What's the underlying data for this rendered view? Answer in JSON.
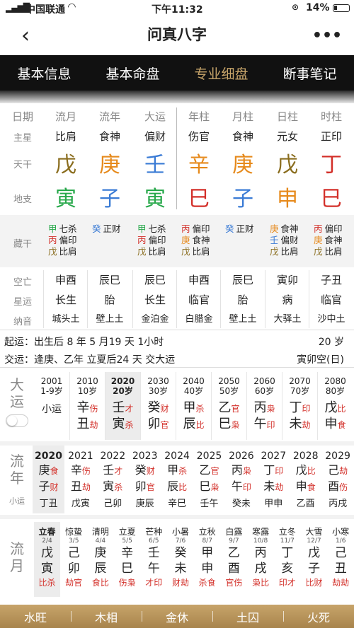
{
  "status": {
    "carrier": "中国联通",
    "time": "下午11:32",
    "battery": "14%"
  },
  "nav": {
    "title": "问真八字"
  },
  "tabs": [
    "基本信息",
    "基本命盘",
    "专业细盘",
    "断事笔记"
  ],
  "headers": [
    "日期",
    "流月",
    "流年",
    "大运",
    "年柱",
    "月柱",
    "日柱",
    "时柱"
  ],
  "zhuxing": {
    "label": "主星",
    "values": [
      "比肩",
      "食神",
      "偏财",
      "伤官",
      "食神",
      "元女",
      "正印"
    ]
  },
  "tiangan": {
    "label": "天干",
    "chars": [
      "戊",
      "庚",
      "壬",
      "辛",
      "庚",
      "戊",
      "丁"
    ],
    "colors": [
      "#8a6d1e",
      "#e68a1c",
      "#3a7bd5",
      "#e68a1c",
      "#e68a1c",
      "#8a6d1e",
      "#d3302a"
    ]
  },
  "dizhi": {
    "label": "地支",
    "chars": [
      "寅",
      "子",
      "寅",
      "巳",
      "子",
      "申",
      "巳"
    ],
    "colors": [
      "#27a84a",
      "#3a7bd5",
      "#27a84a",
      "#d3302a",
      "#3a7bd5",
      "#e68a1c",
      "#d3302a"
    ]
  },
  "canggan": {
    "label": "藏干",
    "cols": [
      [
        [
          "甲",
          "七杀",
          "#27a84a"
        ],
        [
          "丙",
          "偏印",
          "#d3302a"
        ],
        [
          "戊",
          "比肩",
          "#8a6d1e"
        ]
      ],
      [
        [
          "癸",
          "正财",
          "#3a7bd5"
        ]
      ],
      [
        [
          "甲",
          "七杀",
          "#27a84a"
        ],
        [
          "丙",
          "偏印",
          "#d3302a"
        ],
        [
          "戊",
          "比肩",
          "#8a6d1e"
        ]
      ],
      [
        [
          "丙",
          "偏印",
          "#d3302a"
        ],
        [
          "庚",
          "食神",
          "#e68a1c"
        ],
        [
          "戊",
          "比肩",
          "#8a6d1e"
        ]
      ],
      [
        [
          "癸",
          "正财",
          "#3a7bd5"
        ]
      ],
      [
        [
          "庚",
          "食神",
          "#e68a1c"
        ],
        [
          "壬",
          "偏财",
          "#3a7bd5"
        ],
        [
          "戊",
          "比肩",
          "#8a6d1e"
        ]
      ],
      [
        [
          "丙",
          "偏印",
          "#d3302a"
        ],
        [
          "庚",
          "食神",
          "#e68a1c"
        ],
        [
          "戊",
          "比肩",
          "#8a6d1e"
        ]
      ]
    ]
  },
  "kongwang": {
    "label": "空亡",
    "values": [
      "申酉",
      "辰巳",
      "辰巳",
      "申酉",
      "辰巳",
      "寅卯",
      "子丑"
    ]
  },
  "xingyun": {
    "label": "星运",
    "values": [
      "长生",
      "胎",
      "长生",
      "临官",
      "胎",
      "病",
      "临官"
    ]
  },
  "nayin": {
    "label": "纳音",
    "values": [
      "城头土",
      "壁上土",
      "金泊金",
      "白腊金",
      "壁上土",
      "大驿土",
      "沙中土"
    ]
  },
  "qiyun": {
    "text": "起运：出生后 8 年 5 月19 天 1小时",
    "age": "20 岁"
  },
  "jiaoyun": {
    "text": "交运：逢庚、乙年 立夏后24 天 交大运",
    "kong": "寅卯空(日)"
  },
  "dayun": {
    "label": "大运",
    "cols": [
      {
        "year": "2001",
        "age": "1-9岁",
        "name": "小运",
        "gz": []
      },
      {
        "year": "2010",
        "age": "10岁",
        "gz": [
          [
            "辛",
            "伤",
            "#e68a1c"
          ],
          [
            "丑",
            "劫",
            "#8a6d1e"
          ]
        ]
      },
      {
        "year": "2020",
        "age": "20岁",
        "gz": [
          [
            "壬",
            "才",
            "#3a7bd5"
          ],
          [
            "寅",
            "杀",
            "#27a84a"
          ]
        ],
        "active": true
      },
      {
        "year": "2030",
        "age": "30岁",
        "gz": [
          [
            "癸",
            "财",
            "#3a7bd5"
          ],
          [
            "卯",
            "官",
            "#27a84a"
          ]
        ]
      },
      {
        "year": "2040",
        "age": "40岁",
        "gz": [
          [
            "甲",
            "杀",
            "#27a84a"
          ],
          [
            "辰",
            "比",
            "#8a6d1e"
          ]
        ]
      },
      {
        "year": "2050",
        "age": "50岁",
        "gz": [
          [
            "乙",
            "官",
            "#27a84a"
          ],
          [
            "巳",
            "枭",
            "#d3302a"
          ]
        ]
      },
      {
        "year": "2060",
        "age": "60岁",
        "gz": [
          [
            "丙",
            "枭",
            "#d3302a"
          ],
          [
            "午",
            "印",
            "#d3302a"
          ]
        ]
      },
      {
        "year": "2070",
        "age": "70岁",
        "gz": [
          [
            "丁",
            "印",
            "#d3302a"
          ],
          [
            "未",
            "劫",
            "#8a6d1e"
          ]
        ]
      },
      {
        "year": "2080",
        "age": "80岁",
        "gz": [
          [
            "戊",
            "比",
            "#8a6d1e"
          ],
          [
            "申",
            "食",
            "#e68a1c"
          ]
        ]
      }
    ]
  },
  "liunian": {
    "label": "流年",
    "sub": "小运",
    "cols": [
      {
        "year": "2020",
        "gz": [
          [
            "庚",
            "食",
            "#e68a1c"
          ],
          [
            "子",
            "财",
            "#3a7bd5"
          ]
        ],
        "xy": "丁丑",
        "active": true
      },
      {
        "year": "2021",
        "gz": [
          [
            "辛",
            "伤",
            "#e68a1c"
          ],
          [
            "丑",
            "劫",
            "#8a6d1e"
          ]
        ],
        "xy": "戊寅"
      },
      {
        "year": "2022",
        "gz": [
          [
            "壬",
            "才",
            "#3a7bd5"
          ],
          [
            "寅",
            "杀",
            "#27a84a"
          ]
        ],
        "xy": "己卯"
      },
      {
        "year": "2023",
        "gz": [
          [
            "癸",
            "财",
            "#3a7bd5"
          ],
          [
            "卯",
            "官",
            "#27a84a"
          ]
        ],
        "xy": "庚辰"
      },
      {
        "year": "2024",
        "gz": [
          [
            "甲",
            "杀",
            "#27a84a"
          ],
          [
            "辰",
            "比",
            "#8a6d1e"
          ]
        ],
        "xy": "辛巳"
      },
      {
        "year": "2025",
        "gz": [
          [
            "乙",
            "官",
            "#27a84a"
          ],
          [
            "巳",
            "枭",
            "#d3302a"
          ]
        ],
        "xy": "壬午"
      },
      {
        "year": "2026",
        "gz": [
          [
            "丙",
            "枭",
            "#d3302a"
          ],
          [
            "午",
            "印",
            "#d3302a"
          ]
        ],
        "xy": "癸未"
      },
      {
        "year": "2027",
        "gz": [
          [
            "丁",
            "印",
            "#d3302a"
          ],
          [
            "未",
            "劫",
            "#8a6d1e"
          ]
        ],
        "xy": "甲申"
      },
      {
        "year": "2028",
        "gz": [
          [
            "戊",
            "比",
            "#8a6d1e"
          ],
          [
            "申",
            "食",
            "#e68a1c"
          ]
        ],
        "xy": "乙酉"
      },
      {
        "year": "2029",
        "gz": [
          [
            "己",
            "劫",
            "#8a6d1e"
          ],
          [
            "酉",
            "伤",
            "#e68a1c"
          ]
        ],
        "xy": "丙戌"
      }
    ]
  },
  "liuyue": {
    "label": "流月",
    "cols": [
      {
        "jie": "立春",
        "date": "2/4",
        "gz": [
          "戊",
          "寅"
        ],
        "ss": "比杀",
        "active": true
      },
      {
        "jie": "惊蛰",
        "date": "3/5",
        "gz": [
          "己",
          "卯"
        ],
        "ss": "劫官"
      },
      {
        "jie": "清明",
        "date": "4/4",
        "gz": [
          "庚",
          "辰"
        ],
        "ss": "食比"
      },
      {
        "jie": "立夏",
        "date": "5/5",
        "gz": [
          "辛",
          "巳"
        ],
        "ss": "伤枭"
      },
      {
        "jie": "芒种",
        "date": "6/5",
        "gz": [
          "壬",
          "午"
        ],
        "ss": "才印"
      },
      {
        "jie": "小暑",
        "date": "7/6",
        "gz": [
          "癸",
          "未"
        ],
        "ss": "财劫"
      },
      {
        "jie": "立秋",
        "date": "8/7",
        "gz": [
          "甲",
          "申"
        ],
        "ss": "杀食"
      },
      {
        "jie": "白露",
        "date": "9/7",
        "gz": [
          "乙",
          "酉"
        ],
        "ss": "官伤"
      },
      {
        "jie": "寒露",
        "date": "10/8",
        "gz": [
          "丙",
          "戌"
        ],
        "ss": "枭比"
      },
      {
        "jie": "立冬",
        "date": "11/7",
        "gz": [
          "丁",
          "亥"
        ],
        "ss": "印才"
      },
      {
        "jie": "大雪",
        "date": "12/7",
        "gz": [
          "戊",
          "子"
        ],
        "ss": "比财"
      },
      {
        "jie": "小寒",
        "date": "1/6",
        "gz": [
          "己",
          "丑"
        ],
        "ss": "劫劫"
      }
    ]
  },
  "bottom": [
    "水旺",
    "木相",
    "金休",
    "土囚",
    "火死"
  ]
}
